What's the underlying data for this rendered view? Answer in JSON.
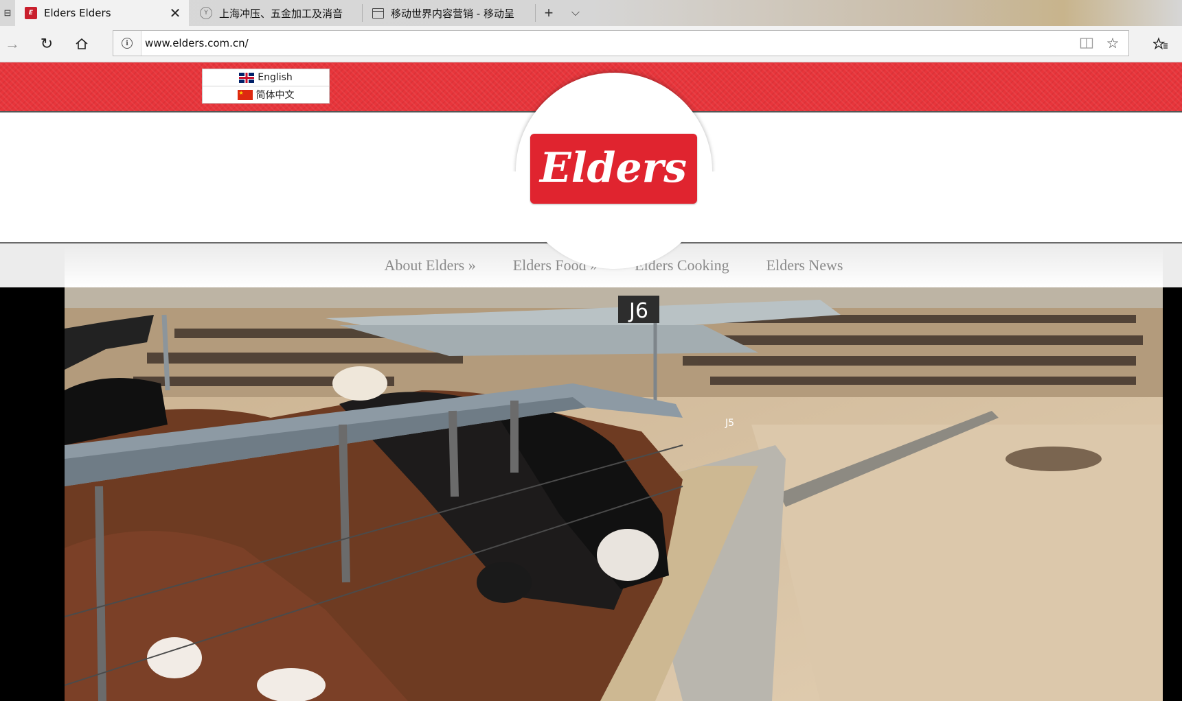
{
  "browser": {
    "tabs": [
      {
        "title": "Elders Elders",
        "active": true,
        "favicon": "elders-favicon"
      },
      {
        "title": "上海冲压、五金加工及消音",
        "active": false,
        "favicon": "site-favicon"
      },
      {
        "title": "移动世界内容营销 - 移动呈",
        "active": false,
        "favicon": "page-icon"
      }
    ],
    "new_tab_glyph": "+",
    "tab_list_glyph": "⌵",
    "close_glyph": "✕",
    "url": "www.elders.com.cn/",
    "info_glyph": "i"
  },
  "site": {
    "languages": [
      {
        "label": "English",
        "flag": "uk-flag"
      },
      {
        "label": "简体中文",
        "flag": "china-flag"
      }
    ],
    "logo_text": "Elders",
    "brand_color": "#e0242f",
    "menu": [
      {
        "label": "About Elders »"
      },
      {
        "label": "Elders Food »"
      },
      {
        "label": "Elders Cooking"
      },
      {
        "label": "Elders News"
      }
    ],
    "hero_sign": "J6",
    "hero_sign_small": "J5"
  }
}
